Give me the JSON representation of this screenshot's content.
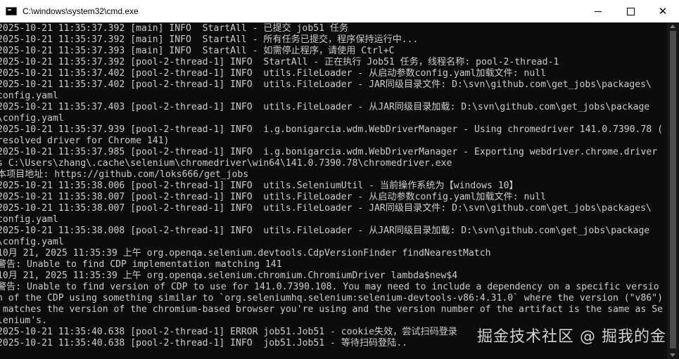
{
  "window": {
    "title": "C:\\windows\\system32\\cmd.exe",
    "controls": {
      "minimize_icon": "minimize-icon",
      "maximize_icon": "maximize-icon",
      "close_glyph": "✕"
    }
  },
  "console": {
    "text_color": "#cccccc",
    "background_color": "#0c0c0c",
    "lines": [
      "2025-10-21 11:35:37.392 [main] INFO  StartAll - 已提交 job51 任务",
      "2025-10-21 11:35:37.392 [main] INFO  StartAll - 所有任务已提交，程序保持运行中...",
      "2025-10-21 11:35:37.393 [main] INFO  StartAll - 如需停止程序，请使用 Ctrl+C",
      "2025-10-21 11:35:37.392 [pool-2-thread-1] INFO  StartAll - 正在执行 Job51 任务，线程名称: pool-2-thread-1",
      "2025-10-21 11:35:37.402 [pool-2-thread-1] INFO  utils.FileLoader - 从启动参数config.yaml加载文件: null",
      "2025-10-21 11:35:37.402 [pool-2-thread-1] INFO  utils.FileLoader - JAR同级目录文件: D:\\svn\\github.com\\get_jobs\\packages\\",
      "config.yaml",
      "2025-10-21 11:35:37.403 [pool-2-thread-1] INFO  utils.FileLoader - 从JAR同级目录加载: D:\\svn\\github.com\\get_jobs\\package",
      "\\config.yaml",
      "2025-10-21 11:35:37.939 [pool-2-thread-1] INFO  i.g.bonigarcia.wdm.WebDriverManager - Using chromedriver 141.0.7390.78 (",
      "resolved driver for Chrome 141)",
      "2025-10-21 11:35:37.985 [pool-2-thread-1] INFO  i.g.bonigarcia.wdm.WebDriverManager - Exporting webdriver.chrome.driver",
      "s C:\\Users\\zhang\\.cache\\selenium\\chromedriver\\win64\\141.0.7390.78\\chromedriver.exe",
      "本项目地址: https://github.com/loks666/get_jobs",
      "2025-10-21 11:35:38.006 [pool-2-thread-1] INFO  utils.SeleniumUtil - 当前操作系统为【windows 10】",
      "2025-10-21 11:35:38.007 [pool-2-thread-1] INFO  utils.FileLoader - 从启动参数config.yaml加载文件: null",
      "2025-10-21 11:35:38.007 [pool-2-thread-1] INFO  utils.FileLoader - JAR同级目录文件: D:\\svn\\github.com\\get_jobs\\packages\\",
      "config.yaml",
      "2025-10-21 11:35:38.008 [pool-2-thread-1] INFO  utils.FileLoader - 从JAR同级目录加载: D:\\svn\\github.com\\get_jobs\\package",
      "\\config.yaml",
      "10月 21, 2025 11:35:39 上午 org.openqa.selenium.devtools.CdpVersionFinder findNearestMatch",
      "警告: Unable to find CDP implementation matching 141",
      "10月 21, 2025 11:35:39 上午 org.openqa.selenium.chromium.ChromiumDriver lambda$new$4",
      "警告: Unable to find version of CDP to use for 141.0.7390.108. You may need to include a dependency on a specific versio",
      "n of the CDP using something similar to `org.seleniumhq.selenium:selenium-devtools-v86:4.31.0` where the version (\"v86\")",
      " matches the version of the chromium-based browser you're using and the version number of the artifact is the same as Se",
      "lenium's.",
      "2025-10-21 11:35:40.638 [pool-2-thread-1] ERROR job51.Job51 - cookie失效，尝试扫码登录",
      "2025-10-21 11:35:40.638 [pool-2-thread-1] INFO  job51.Job51 - 等待扫码登陆.."
    ]
  },
  "watermark": {
    "text": "掘金技术社区 @ 掘我的金"
  }
}
